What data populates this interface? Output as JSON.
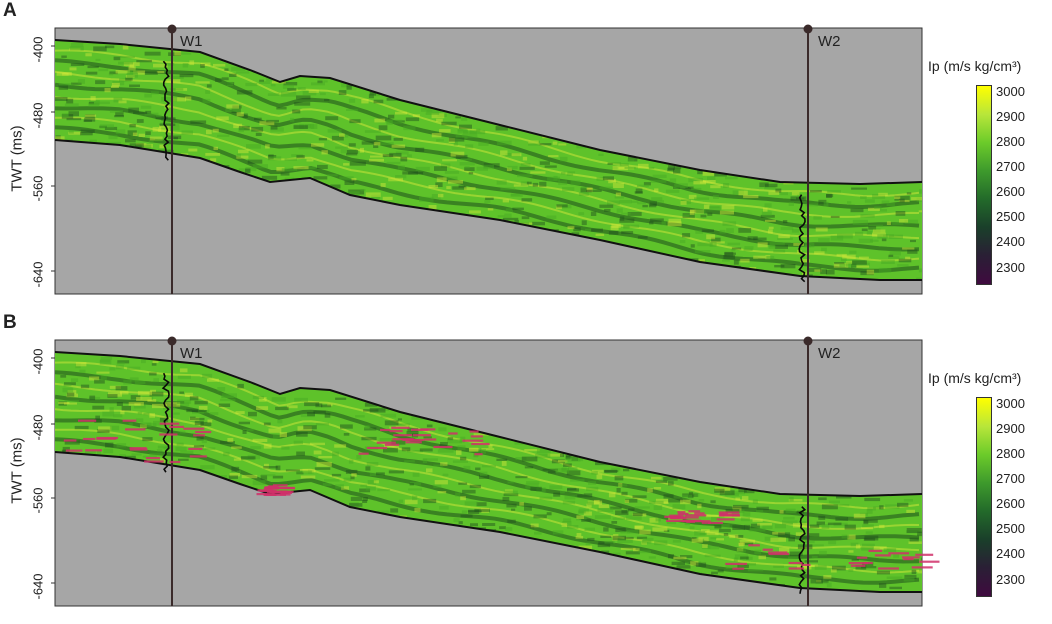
{
  "panels": [
    {
      "letter": "A",
      "ylabel": "TWT (ms)",
      "yticks": [
        "-400",
        "-480",
        "-560",
        "-640"
      ],
      "wells": [
        "W1",
        "W2"
      ],
      "colorbar": {
        "title": "Ip (m/s kg/cm³)",
        "ticks": [
          "3000",
          "2900",
          "2800",
          "2700",
          "2600",
          "2500",
          "2400",
          "2300"
        ]
      },
      "highlights": false
    },
    {
      "letter": "B",
      "ylabel": "TWT (ms)",
      "yticks": [
        "-400",
        "-480",
        "-560",
        "-640"
      ],
      "wells": [
        "W1",
        "W2"
      ],
      "colorbar": {
        "title": "Ip (m/s kg/cm³)",
        "ticks": [
          "3000",
          "2900",
          "2800",
          "2700",
          "2600",
          "2500",
          "2400",
          "2300"
        ]
      },
      "highlights": true
    }
  ],
  "colors": {
    "background": "#a6a6a6",
    "section_green": "#5ec22a",
    "bright_yellow": "#d4e83a",
    "dark_band": "#1e4e1c",
    "highlight_red": "#d0306a",
    "well_line": "#3a2a2a",
    "colorbar_stops": [
      "#ffff00",
      "#b8e63a",
      "#6ccb2a",
      "#3e9a2c",
      "#236a2a",
      "#1a3f2a",
      "#2a1f35",
      "#3f0a3f"
    ]
  }
}
